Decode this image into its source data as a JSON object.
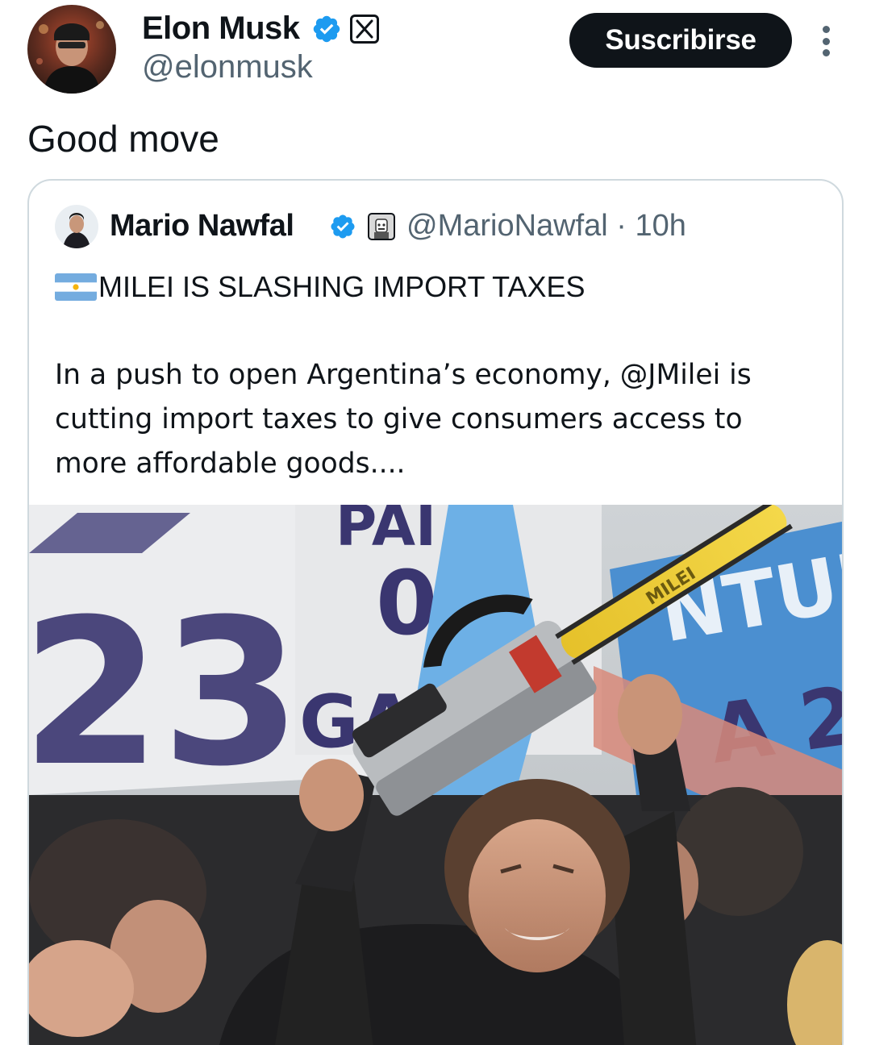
{
  "tweet": {
    "author": {
      "name": "Elon Musk",
      "handle": "@elonmusk",
      "verified": true,
      "affiliation_icon": "x-logo-icon"
    },
    "subscribe_label": "Suscribirse",
    "text": "Good move"
  },
  "quoted_tweet": {
    "author": {
      "name": "Mario Nawfal",
      "handle": "@MarioNawfal",
      "verified": true,
      "affiliation_icon": "robot-badge-icon"
    },
    "time": "10h",
    "headline": "MILEI IS SLASHING IMPORT TAXES",
    "flag_icon": "argentina-flag-icon",
    "body": "In a push to open Argentina’s economy, @JMilei is\ncutting import taxes to give consumers access to\nmore affordable goods...."
  },
  "colors": {
    "text_primary": "#0f1419",
    "text_secondary": "#536471",
    "verified_blue": "#1d9bf0",
    "border": "#cfd9de",
    "button_bg": "#0f1419"
  }
}
